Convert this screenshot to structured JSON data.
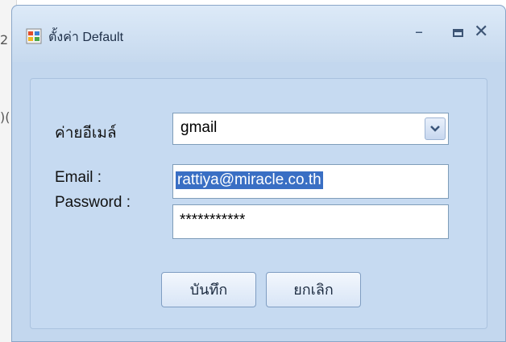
{
  "window": {
    "title": "ตั้งค่า Default",
    "icon": "app-window-icon",
    "controls": {
      "minimize": "minimize-icon",
      "maximize": "maximize-icon",
      "close": "close-icon"
    }
  },
  "form": {
    "provider_label": "ค่ายอีเมล์",
    "provider_value": "gmail",
    "email_label": "Email :",
    "email_value": "rattiya@miracle.co.th",
    "password_label": "Password :",
    "password_value": "***********"
  },
  "buttons": {
    "save": "บันทึก",
    "cancel": "ยกเลิก"
  },
  "background": {
    "fragments": [
      "2",
      ")("
    ]
  },
  "colors": {
    "dialog_bg": "#c3d7ee",
    "selection": "#3a6fc4"
  }
}
